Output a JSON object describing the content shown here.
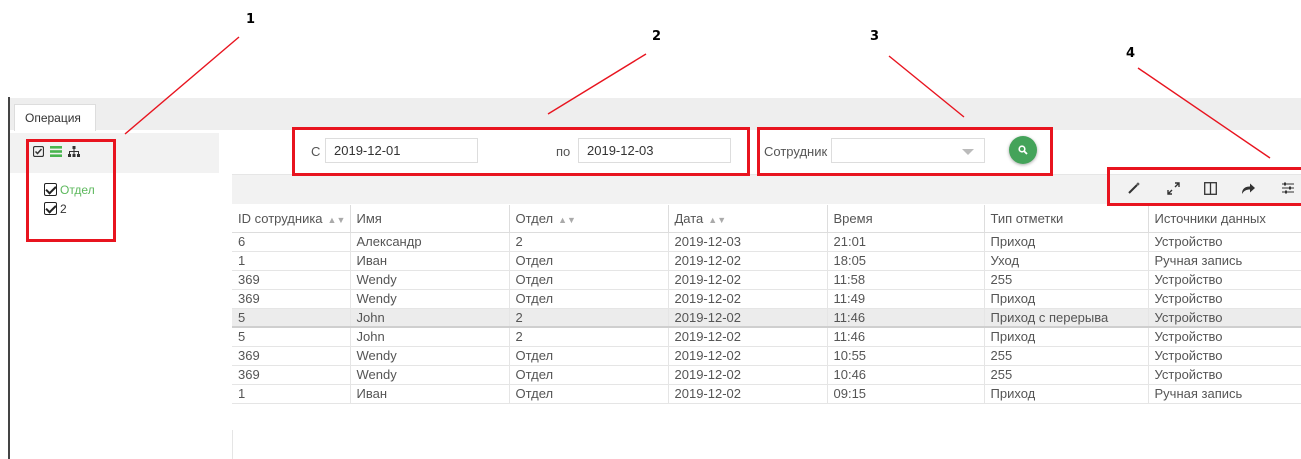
{
  "annotations": [
    "1",
    "2",
    "3",
    "4"
  ],
  "tabs": [
    {
      "label": "Операция"
    }
  ],
  "tree": {
    "tool_icons": [
      "check-all-icon",
      "list-icon",
      "hierarchy-icon"
    ],
    "items": [
      {
        "label": "Отдел",
        "checked": true
      },
      {
        "label": "2",
        "checked": true
      }
    ]
  },
  "filter": {
    "from_label": "С",
    "from_value": "2019-12-01",
    "to_label": "по",
    "to_value": "2019-12-03",
    "employee_label": "Сотрудник",
    "employee_value": ""
  },
  "toolbar": {
    "icons": [
      "magic-wand-icon",
      "expand-icon",
      "columns-icon",
      "export-icon",
      "settings-sliders-icon"
    ]
  },
  "table": {
    "columns": [
      "ID сотрудника",
      "Имя",
      "Отдел",
      "Дата",
      "Время",
      "Тип отметки",
      "Источники данных"
    ],
    "rows": [
      [
        "6",
        "Александр",
        "2",
        "2019-12-03",
        "21:01",
        "Приход",
        "Устройство"
      ],
      [
        "1",
        "Иван",
        "Отдел",
        "2019-12-02",
        "18:05",
        "Уход",
        "Ручная запись"
      ],
      [
        "369",
        "Wendy",
        "Отдел",
        "2019-12-02",
        "11:58",
        "255",
        "Устройство"
      ],
      [
        "369",
        "Wendy",
        "Отдел",
        "2019-12-02",
        "11:49",
        "Приход",
        "Устройство"
      ],
      [
        "5",
        "John",
        "2",
        "2019-12-02",
        "11:46",
        "Приход с перерыва",
        "Устройство"
      ],
      [
        "5",
        "John",
        "2",
        "2019-12-02",
        "11:46",
        "Приход",
        "Устройство"
      ],
      [
        "369",
        "Wendy",
        "Отдел",
        "2019-12-02",
        "10:55",
        "255",
        "Устройство"
      ],
      [
        "369",
        "Wendy",
        "Отдел",
        "2019-12-02",
        "10:46",
        "255",
        "Устройство"
      ],
      [
        "1",
        "Иван",
        "Отдел",
        "2019-12-02",
        "09:15",
        "Приход",
        "Ручная запись"
      ]
    ],
    "selected_row_index": 4
  },
  "colors": {
    "annotation_red": "#e8141f",
    "search_button": "#44a35a",
    "tree_item_green": "#5cb85c"
  }
}
